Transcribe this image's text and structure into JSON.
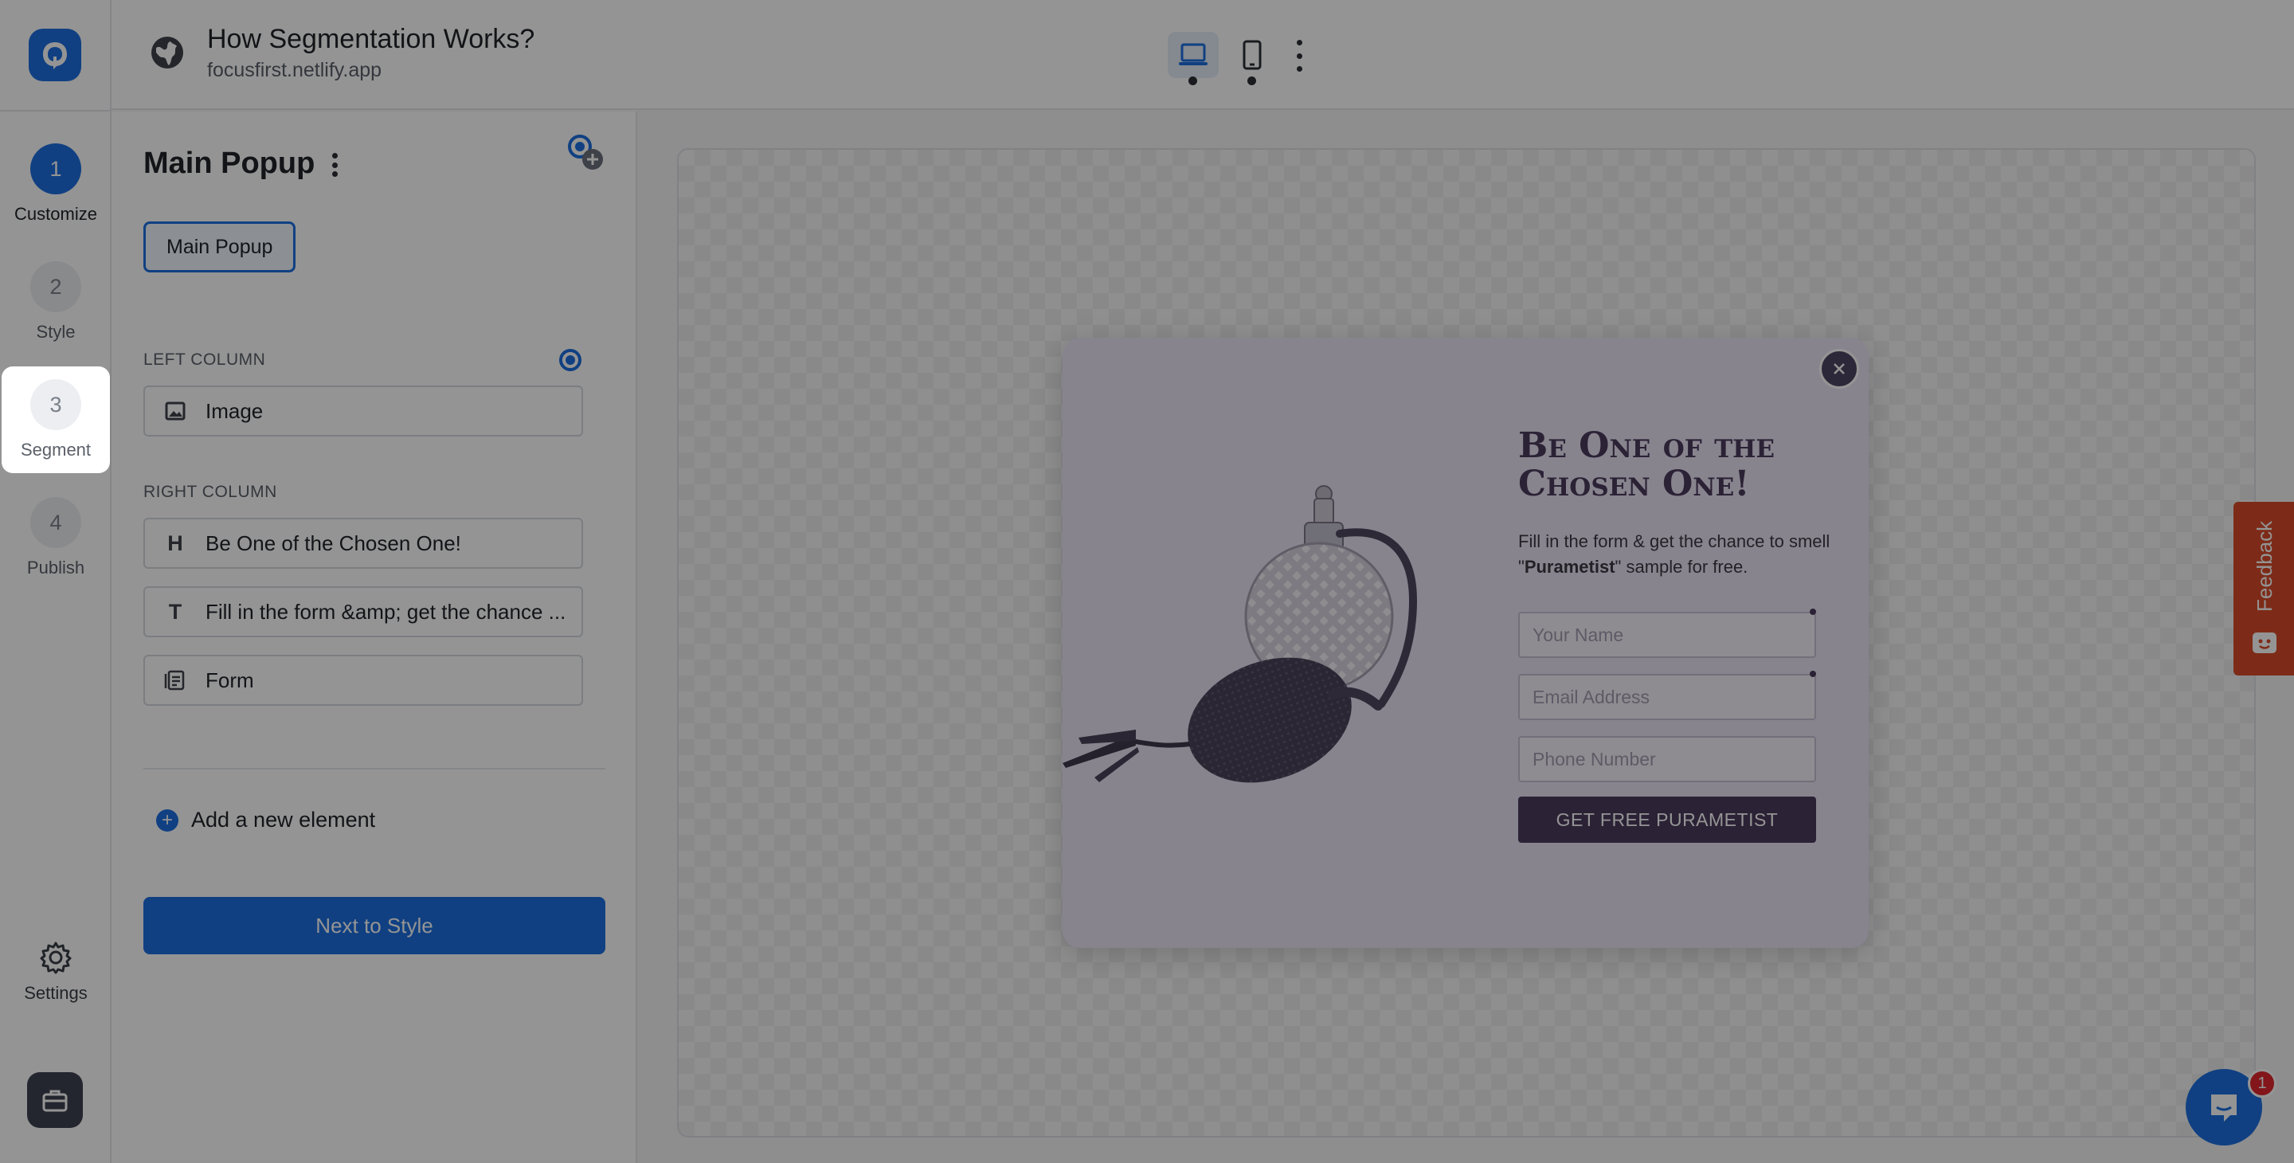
{
  "header": {
    "site_title": "How Segmentation Works?",
    "site_domain": "focusfirst.netlify.app",
    "devices": [
      "desktop",
      "mobile"
    ],
    "active_device": "desktop"
  },
  "rail": {
    "steps": [
      {
        "number": "1",
        "label": "Customize",
        "state": "current"
      },
      {
        "number": "2",
        "label": "Style",
        "state": "inactive"
      },
      {
        "number": "3",
        "label": "Segment",
        "state": "highlighted"
      },
      {
        "number": "4",
        "label": "Publish",
        "state": "inactive"
      }
    ],
    "settings_label": "Settings"
  },
  "panel": {
    "title": "Main Popup",
    "variant_chip": "Main Popup",
    "left_column_heading": "LEFT COLUMN",
    "right_column_heading": "RIGHT COLUMN",
    "left_elements": [
      {
        "icon": "image-icon",
        "label": "Image"
      }
    ],
    "right_elements": [
      {
        "icon": "H",
        "label": "Be One of the Chosen One!"
      },
      {
        "icon": "T",
        "label": "Fill in the form &amp; get the chance ..."
      },
      {
        "icon": "form-icon",
        "label": "Form"
      }
    ],
    "add_element_label": "Add a new element",
    "next_button_label": "Next to Style"
  },
  "popup": {
    "heading": "Be One of the Chosen One!",
    "text_before": "Fill in the form & get the chance to smell \"",
    "text_bold": "Purametist",
    "text_after": "\" sample for free.",
    "fields": [
      {
        "placeholder": "Your Name",
        "required": true
      },
      {
        "placeholder": "Email Address",
        "required": true
      },
      {
        "placeholder": "Phone Number",
        "required": false
      }
    ],
    "submit_label": "GET FREE PURAMETIST"
  },
  "widgets": {
    "feedback_label": "Feedback",
    "chat_badge_count": "1"
  },
  "colors": {
    "accent": "#1d6fe0",
    "popup_primary": "#4a3c5e",
    "popup_background": "#ebe4f4",
    "feedback": "#d84b2a",
    "overlay": "rgba(0,0,0,0.42)"
  }
}
